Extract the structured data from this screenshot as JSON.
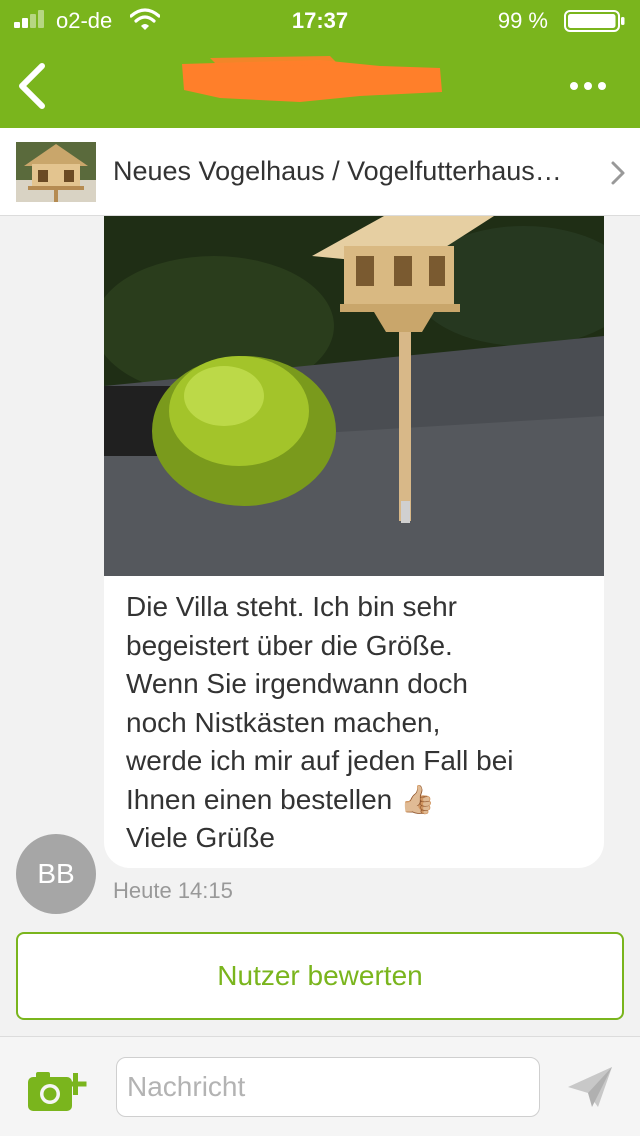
{
  "colors": {
    "brand": "#7ab51d",
    "background": "#f2f2f2",
    "text": "#333333",
    "muted": "#999999",
    "avatar": "#a6a6a6",
    "redaction": "#ff7f2a"
  },
  "status_bar": {
    "carrier": "o2-de",
    "time": "17:37",
    "battery": "99 %",
    "battery_level": 0.99
  },
  "header": {
    "back_icon": "chevron-left-icon",
    "title_redacted": true,
    "more_icon": "ellipsis-icon"
  },
  "listing": {
    "title": "Neues Vogelhaus / Vogelfutterhaus…",
    "chevron_icon": "chevron-right-icon"
  },
  "message": {
    "text": "Die Villa steht. Ich bin sehr\nbegeistert über die Größe.\nWenn Sie irgendwann doch\nnoch Nistkästen machen,\nwerde ich mir auf jeden Fall bei\nIhnen einen bestellen 👍🏼\nViele Grüße",
    "sender_initials": "BB",
    "timestamp": "Heute 14:15"
  },
  "rate_button": {
    "label": "Nutzer bewerten"
  },
  "composer": {
    "placeholder": "Nachricht",
    "camera_icon": "camera-plus-icon",
    "send_icon": "send-icon"
  }
}
